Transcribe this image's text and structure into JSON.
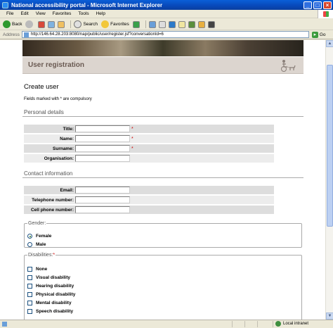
{
  "window": {
    "title": "National accessibility portal - Microsoft Internet Explorer",
    "minimize": "_",
    "maximize": "□",
    "close": "×"
  },
  "menu": [
    "File",
    "Edit",
    "View",
    "Favorites",
    "Tools",
    "Help"
  ],
  "toolbar": {
    "back": "Back",
    "search": "Search",
    "favorites": "Favorites"
  },
  "address": {
    "label": "Address",
    "url": "http://146.64.28.203:8080/nap/public/user/register.jsf?conversationId=6",
    "go": "Go"
  },
  "page": {
    "banner_title": "User registration",
    "heading": "Create user",
    "compulsory_note": "Fields marked with * are compulsory",
    "required_mark": "*",
    "personal": {
      "title": "Personal details",
      "fields": [
        {
          "label": "Title:",
          "value": ""
        },
        {
          "label": "Name:",
          "value": ""
        },
        {
          "label": "Surname:",
          "value": ""
        },
        {
          "label": "Organisation:",
          "value": ""
        }
      ]
    },
    "contact": {
      "title": "Contact information",
      "fields": [
        {
          "label": "Email:",
          "value": ""
        },
        {
          "label": "Telephone number:",
          "value": ""
        },
        {
          "label": "Cell phone number:",
          "value": ""
        }
      ]
    },
    "gender": {
      "legend": "Gender:",
      "options": [
        "Female",
        "Male"
      ],
      "selected": "Female"
    },
    "disabilities": {
      "legend": "Disabilities:",
      "options": [
        "None",
        "Visual disability",
        "Hearing disability",
        "Physical disability",
        "Mental disability",
        "Speech disability"
      ]
    }
  },
  "status": {
    "zone": "Local intranet"
  }
}
